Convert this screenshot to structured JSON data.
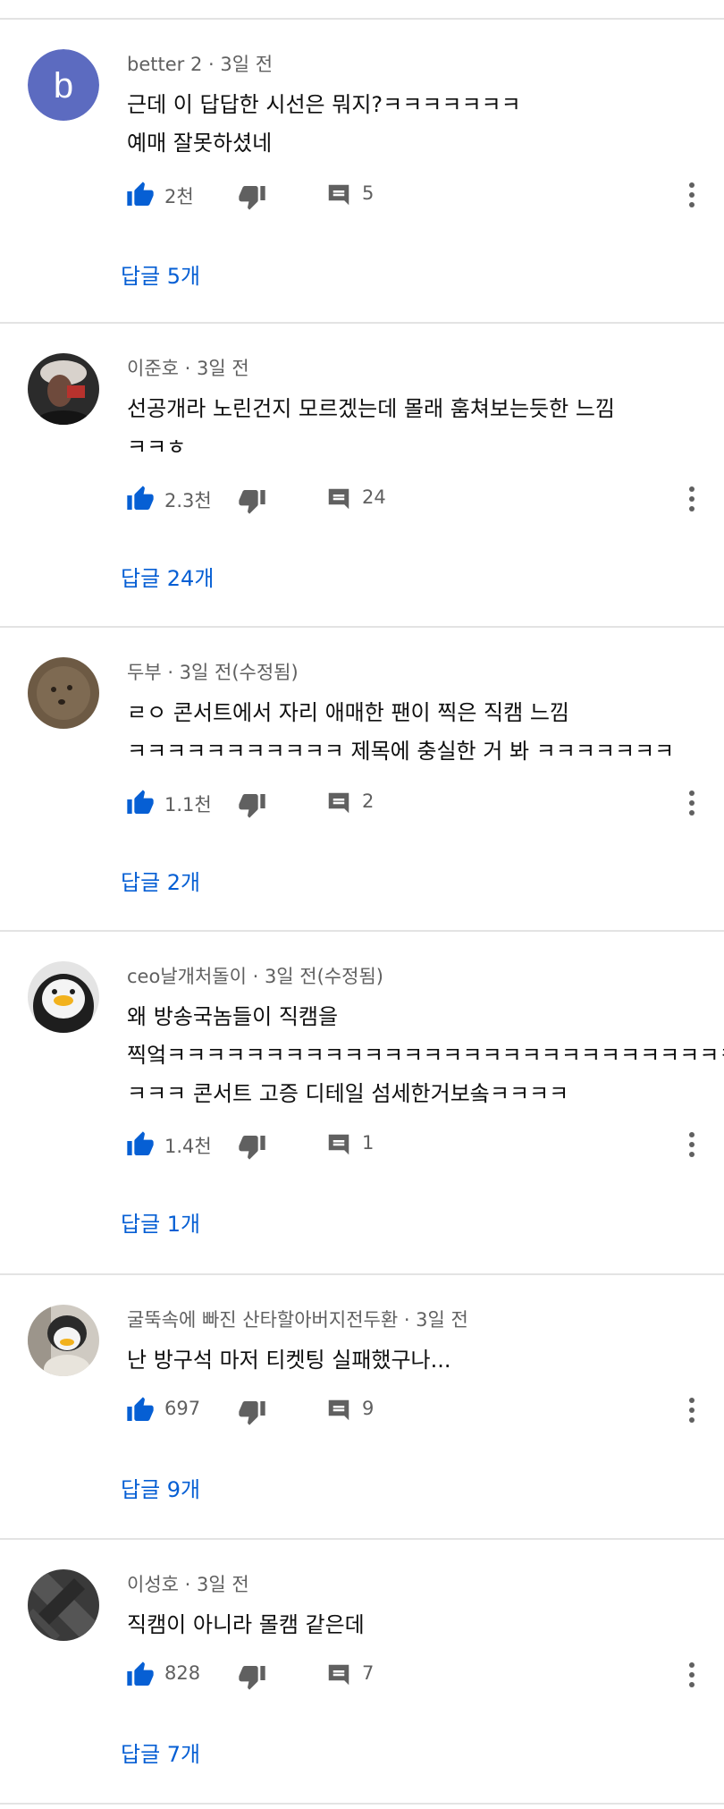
{
  "colors": {
    "link": "#065fd4",
    "like": "#065fd4",
    "icon": "#606060",
    "divider": "#e3e3e3"
  },
  "comments": [
    {
      "author": "better 2",
      "time": "3일 전",
      "meta": "better 2 · 3일 전",
      "lines": [
        "근데 이 답답한 시선은 뭐지?ㅋㅋㅋㅋㅋㅋㅋ",
        "예매 잘못하셨네"
      ],
      "likes": "2천",
      "reply_count": "5",
      "replies_label": "답글 5개",
      "avatar": {
        "type": "letter",
        "letter": "b",
        "color": "#5c6bc0"
      }
    },
    {
      "author": "이준호",
      "time": "3일 전",
      "meta": "이준호 · 3일 전",
      "lines": [
        "선공개라 노린건지 모르겠는데 몰래 훔쳐보는듯한 느낌",
        "ㅋㅋㅎ"
      ],
      "likes": "2.3천",
      "reply_count": "24",
      "replies_label": "답글 24개",
      "avatar": {
        "type": "photo",
        "name": "person-photo-avatar"
      }
    },
    {
      "author": "두부",
      "time": "3일 전(수정됨)",
      "meta": "두부 · 3일 전(수정됨)",
      "lines": [
        "ㄹㅇ 콘서트에서 자리 애매한 팬이 찍은 직캠 느낌",
        "ㅋㅋㅋㅋㅋㅋㅋㅋㅋㅋㅋ 제목에 충실한 거 봐 ㅋㅋㅋㅋㅋㅋㅋ"
      ],
      "likes": "1.1천",
      "reply_count": "2",
      "replies_label": "답글 2개",
      "avatar": {
        "type": "photo",
        "name": "face-photo-avatar"
      }
    },
    {
      "author": "ceo날개처돌이",
      "time": "3일 전(수정됨)",
      "meta": "ceo날개처돌이 · 3일 전(수정됨)",
      "lines": [
        "왜 방송국놈들이 직캠을",
        "찍엌ㅋㅋㅋㅋㅋㅋㅋㅋㅋㅋㅋㅋㅋㅋㅋㅋㅋㅋㅋㅋㅋㅋㅋㅋㅋㅋㅋㅋㅋㅋ",
        "ㅋㅋㅋ 콘서트 고증 디테일 섬세한거보솤ㅋㅋㅋㅋ"
      ],
      "likes": "1.4천",
      "reply_count": "1",
      "replies_label": "답글 1개",
      "avatar": {
        "type": "photo",
        "name": "penguin-avatar"
      }
    },
    {
      "author": "굴뚝속에 빠진 산타할아버지전두환",
      "time": "3일 전",
      "meta": "굴뚝속에 빠진 산타할아버지전두환 · 3일 전",
      "lines": [
        "난 방구석 마저 티켓팅 실패했구나..."
      ],
      "likes": "697",
      "reply_count": "9",
      "replies_label": "답글 9개",
      "avatar": {
        "type": "photo",
        "name": "penguin-costume-avatar"
      }
    },
    {
      "author": "이성호",
      "time": "3일 전",
      "meta": "이성호 · 3일 전",
      "lines": [
        "직캠이 아니라 몰캠 같은데"
      ],
      "likes": "828",
      "reply_count": "7",
      "replies_label": "답글 7개",
      "avatar": {
        "type": "photo",
        "name": "dark-pattern-avatar"
      }
    }
  ]
}
